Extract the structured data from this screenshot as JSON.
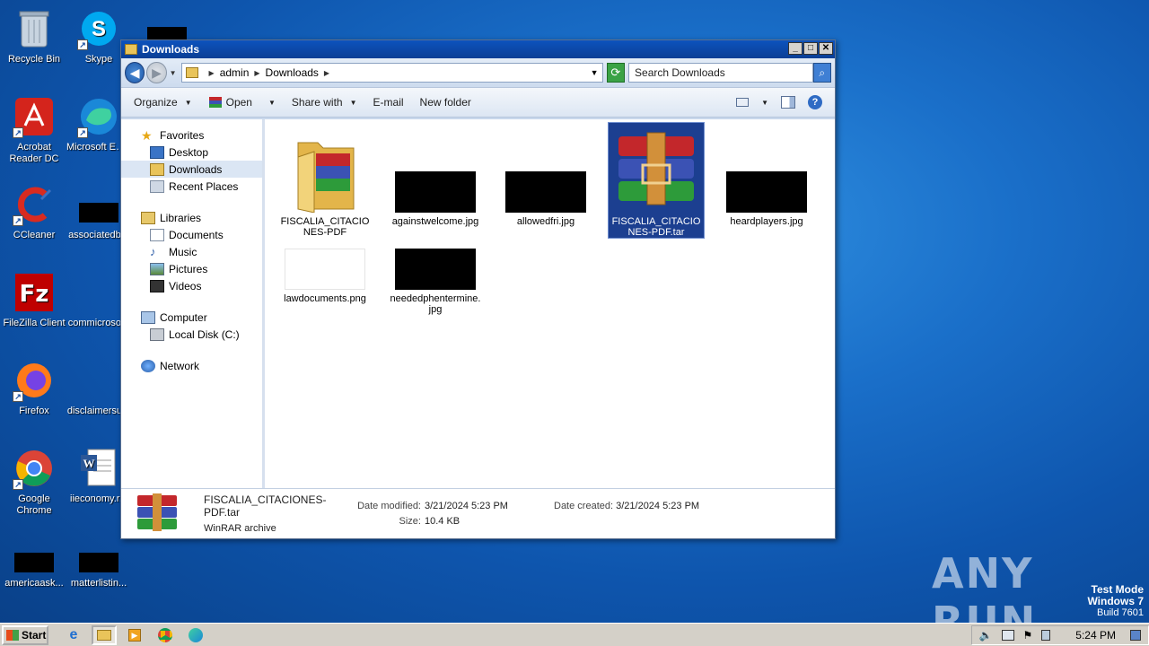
{
  "desktop": {
    "icons": [
      {
        "label": "Recycle Bin"
      },
      {
        "label": "Skype"
      },
      {
        "label": "Acrobat Reader DC"
      },
      {
        "label": "Microsoft Edge"
      },
      {
        "label": "CCleaner"
      },
      {
        "label": "associatedb..."
      },
      {
        "label": "FileZilla Client"
      },
      {
        "label": "commicroso..."
      },
      {
        "label": "Firefox"
      },
      {
        "label": "disclaimersu..."
      },
      {
        "label": "Google Chrome"
      },
      {
        "label": "iieconomy.r..."
      },
      {
        "label": "americaask..."
      },
      {
        "label": "matterlistin..."
      }
    ]
  },
  "window": {
    "title": "Downloads",
    "address": {
      "segments": [
        "admin",
        "Downloads"
      ]
    },
    "search": {
      "placeholder": "Search Downloads"
    },
    "toolbar": {
      "organize": "Organize",
      "open": "Open",
      "share_with": "Share with",
      "email": "E-mail",
      "new_folder": "New folder"
    },
    "nav": {
      "favorites": "Favorites",
      "desktop": "Desktop",
      "downloads": "Downloads",
      "recent_places": "Recent Places",
      "libraries": "Libraries",
      "documents": "Documents",
      "music": "Music",
      "pictures": "Pictures",
      "videos": "Videos",
      "computer": "Computer",
      "local_disk": "Local Disk (C:)",
      "network": "Network"
    },
    "files": [
      {
        "name": "FISCALIA_CITACIONES-PDF",
        "type": "folder"
      },
      {
        "name": "againstwelcome.jpg",
        "type": "image-black"
      },
      {
        "name": "allowedfri.jpg",
        "type": "image-black"
      },
      {
        "name": "FISCALIA_CITACIONES-PDF.tar",
        "type": "winrar",
        "selected": true
      },
      {
        "name": "heardplayers.jpg",
        "type": "image-black"
      },
      {
        "name": "lawdocuments.png",
        "type": "image-white"
      },
      {
        "name": "neededphentermine.jpg",
        "type": "image-black"
      }
    ],
    "details": {
      "filename": "FISCALIA_CITACIONES-PDF.tar",
      "filetype": "WinRAR archive",
      "date_modified_label": "Date modified:",
      "date_modified": "3/21/2024 5:23 PM",
      "size_label": "Size:",
      "size": "10.4 KB",
      "date_created_label": "Date created:",
      "date_created": "3/21/2024 5:23 PM"
    }
  },
  "taskbar": {
    "start": "Start",
    "clock": "5:24 PM"
  },
  "watermark": {
    "line1": "Test Mode",
    "line2": "Windows 7",
    "line3": "Build 7601",
    "brand": "ANY RUN"
  },
  "colors": {
    "titlebar": "#0d53bd",
    "selection": "#1c3f90",
    "desktop": "#1a6fc9"
  }
}
